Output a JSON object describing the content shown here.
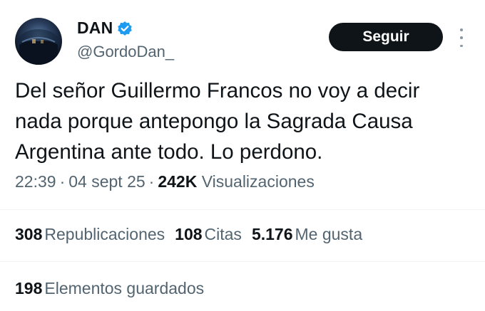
{
  "author": {
    "display_name": "DAN",
    "handle": "@GordoDan_",
    "verified_icon": "verified-badge-icon"
  },
  "follow_label": "Seguir",
  "tweet": {
    "text": "Del señor Guillermo Francos no voy a decir\nnada porque antepongo la Sagrada Causa\nArgentina ante todo. Lo perdono.",
    "time": "22:39",
    "date": "04 sept 25",
    "views_count": "242K",
    "views_label": "Visualizaciones"
  },
  "stats": {
    "retweets": {
      "count": "308",
      "label": "Republicaciones"
    },
    "quotes": {
      "count": "108",
      "label": "Citas"
    },
    "likes": {
      "count": "5.176",
      "label": "Me gusta"
    },
    "bookmarks": {
      "count": "198",
      "label": "Elementos guardados"
    }
  },
  "colors": {
    "text": "#0f1419",
    "secondary": "#536471",
    "verified": "#1d9bf0",
    "button_bg": "#0f1419",
    "divider": "#eff3f4"
  },
  "icons": [
    "verified-badge-icon",
    "more-options-icon"
  ]
}
